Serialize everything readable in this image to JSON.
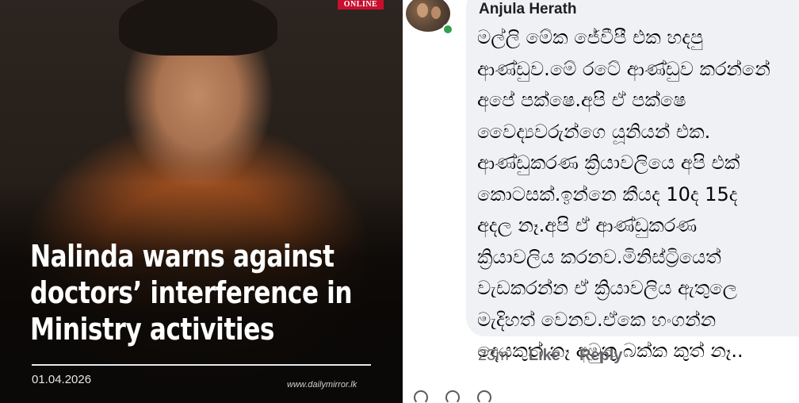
{
  "news_card": {
    "brand_logo_text": "ONLINE",
    "headline_lines": [
      "Nalinda warns against",
      "doctors’ interference in",
      "Ministry activities"
    ],
    "date": "01.04.2026",
    "website": "www.dailymirror.lk"
  },
  "comment": {
    "author": "Anjula Herath",
    "online": true,
    "text_lines": [
      "මල්ලි මේක ජේවීපී එක හදපු",
      "ආණ්ඩුව.මේ රටේ ආණ්ඩුව කරන්නේ",
      "අපේ පක්ෂෙ.අපි ඒ පක්ෂෙ",
      "වෛද්‍යවරුන්ගෙ යූනියන් එක.",
      "ආණ්ඩුකරණ ක්‍රියාවලියෙ අපි එක්",
      "කොටසක්.ඉන්නෙ කීයද 10ද 15ද",
      "අදල නෑ.අපි ඒ ආණ්ඩුකරණ",
      "ක්‍රියාවලිය කරනව.මිනිස්ට්‍රියෙත්",
      "වැඩකරන්න ඒ ක්‍රියාවලිය ඇතුලෙ",
      "මැදිහත් වෙනව.ඒකෙ හංගන්න",
      "දෙයකුත් නෑ අමුතු බක්ක කුත් නෑ.."
    ],
    "time": "23m",
    "like_label": "Like",
    "reply_label": "Reply"
  },
  "colors": {
    "facebook_online_green": "#31a24c",
    "bubble_background": "#eff1f4",
    "news_logo_red": "#c8102e"
  }
}
